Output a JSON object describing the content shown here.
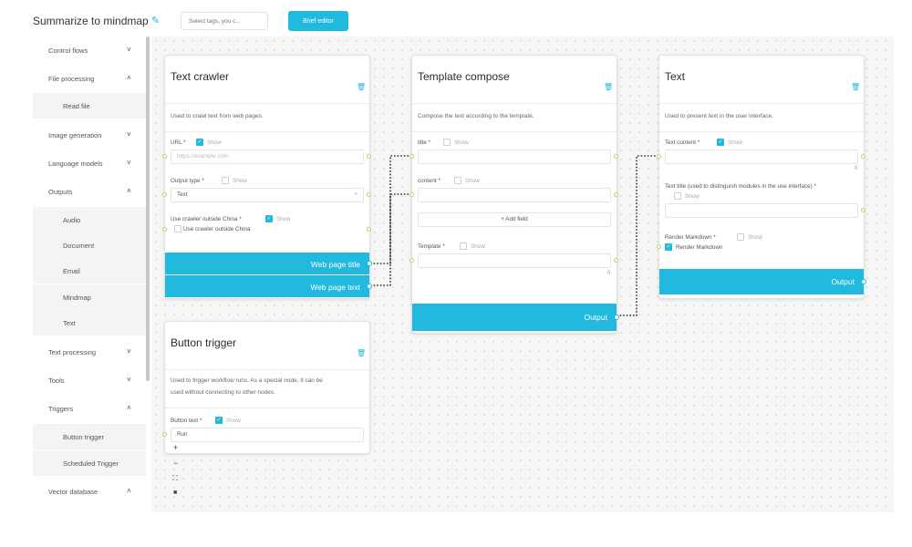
{
  "header": {
    "title": "Summarize to mindmap",
    "tags_placeholder": "Select tags, you c...",
    "brief_editor_label": "Brief editor"
  },
  "sidebar": {
    "items": [
      {
        "label": "Control flows",
        "chevron": "˅"
      },
      {
        "label": "File processing",
        "chevron": "˄"
      },
      {
        "label": "Read file",
        "sub": true
      },
      {
        "label": "Image generation",
        "chevron": "˅"
      },
      {
        "label": "Language models",
        "chevron": "˅"
      },
      {
        "label": "Outputs",
        "chevron": "˄"
      },
      {
        "label": "Audio",
        "sub": true
      },
      {
        "label": "Document",
        "sub": true
      },
      {
        "label": "Email",
        "sub": true
      },
      {
        "label": "Mindmap",
        "sub": true
      },
      {
        "label": "Text",
        "sub": true
      },
      {
        "label": "Text processing",
        "chevron": "˅"
      },
      {
        "label": "Tools",
        "chevron": "˅"
      },
      {
        "label": "Triggers",
        "chevron": "˄"
      },
      {
        "label": "Button trigger",
        "sub": true
      },
      {
        "label": "Scheduled Trigger",
        "sub": true
      },
      {
        "label": "Vector database",
        "chevron": "˄"
      }
    ]
  },
  "nodes": {
    "text_crawler": {
      "title": "Text crawler",
      "description": "Used to crawl text from web pages.",
      "url_label": "URL *",
      "url_placeholder": "https://example.com",
      "show_label": "Show",
      "output_type_label": "Output type *",
      "output_type_value": "Text",
      "crawler_china_label": "Use crawler outside China *",
      "crawler_china_checkbox": "Use crawler outside China",
      "output_title": "Web page title",
      "output_text": "Web page text"
    },
    "template_compose": {
      "title": "Template compose",
      "description": "Compose the text according to the template.",
      "title_label": "title *",
      "content_label": "content *",
      "show_label": "Show",
      "add_field": "Add field",
      "template_label": "Template *",
      "template_count": "0",
      "output": "Output"
    },
    "text_output": {
      "title": "Text",
      "description": "Used to present text in the user interface.",
      "text_content_label": "Text content *",
      "show_label": "Show",
      "content_count": "0",
      "text_title_label": "Text title (used to distinguish modules in the use interface) *",
      "render_markdown_label": "Render Markdown *",
      "render_markdown_checkbox": "Render Markdown",
      "output": "Output"
    },
    "button_trigger": {
      "title": "Button trigger",
      "description_1": "Used to trigger workflow runs. As a special node, it can be",
      "description_2": "used without connecting to other nodes.",
      "button_text_label": "Button text *",
      "show_label": "Show",
      "button_text_value": "Run"
    }
  },
  "colors": {
    "accent": "#21b9de",
    "port": "#b5d36b"
  }
}
